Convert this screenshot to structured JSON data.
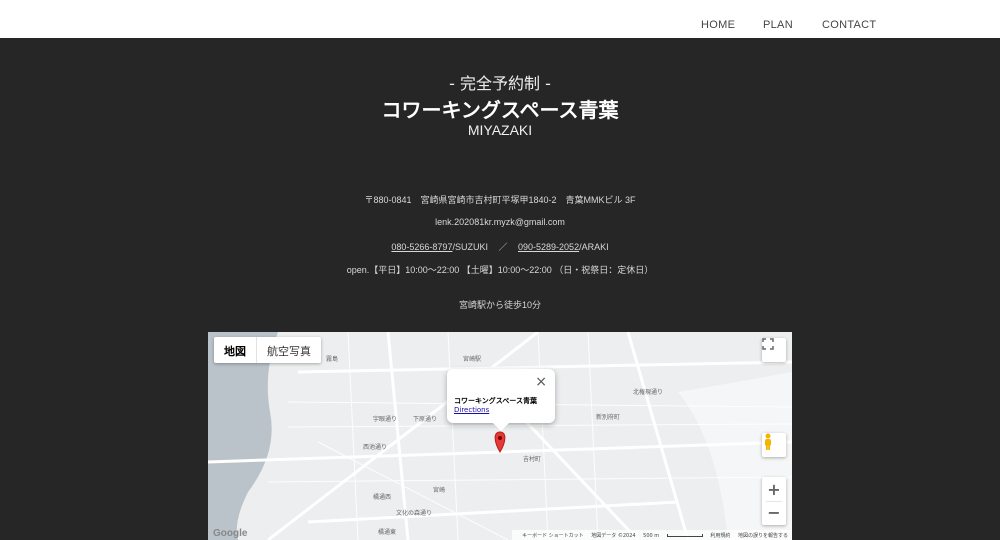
{
  "nav": {
    "home": "HOME",
    "plan": "PLAN",
    "contact": "CONTACT"
  },
  "hero": {
    "tagline": "- 完全予約制 -",
    "title": "コワーキングスペース青葉",
    "city": "MIYAZAKI"
  },
  "info": {
    "address": "〒880-0841　宮崎県宮崎市吉村町平塚甲1840-2　青葉MMKビル 3F",
    "email": "lenk.202081kr.myzk@gmail.com",
    "phone1": "080-5266-8797",
    "phone1_name": "/SUZUKI",
    "phone_sep": "／",
    "phone2": "090-5289-2052",
    "phone2_name": "/ARAKI",
    "hours": "open.【平日】10:00〜22:00 【土曜】10:00〜22:00 （日・祝祭日：定休日）",
    "walk": "宮崎駅から徒歩10分"
  },
  "map": {
    "type_map": "地図",
    "type_satellite": "航空写真",
    "popup_title": "コワーキングスペース青葉",
    "popup_link": "Directions",
    "popup_close": "×",
    "zoom_in": "+",
    "zoom_out": "−",
    "google": "Google",
    "attrib": {
      "shortcuts": "キーボード ショートカット",
      "data": "地図データ ©2024",
      "scale": "500 m",
      "terms": "利用規約",
      "report": "地図の誤りを報告する"
    },
    "labels": {
      "l1": "霧島",
      "l2": "宮崎駅",
      "l3": "北権現通り",
      "l4": "吉村町",
      "l5": "新別府町",
      "l6": "橘通西",
      "l7": "橘通東",
      "l8": "文化の森通り",
      "l9": "宮崎",
      "l10": "西池通り",
      "l11": "宇眼通り",
      "l12": "下原通り"
    },
    "colors": {
      "water": "#b9c3c9",
      "road": "#ffffff",
      "pin": "#e53935"
    }
  }
}
